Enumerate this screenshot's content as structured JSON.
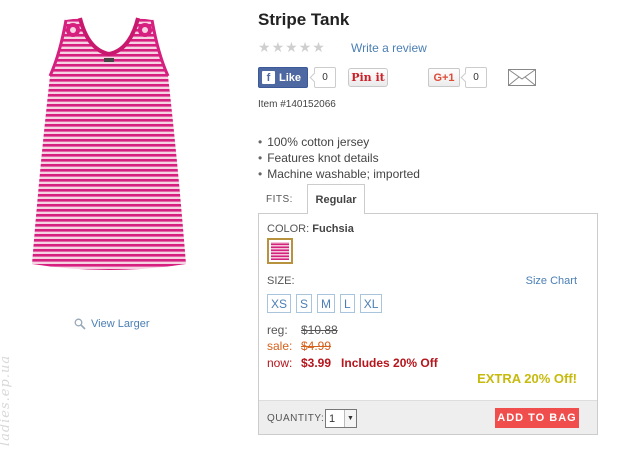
{
  "product": {
    "title": "Stripe Tank",
    "image_alt": "Fuchsia and white striped tank top with knot details",
    "item_number": "Item #140152066",
    "view_larger": "View Larger",
    "features": [
      "100% cotton jersey",
      "Features knot details",
      "Machine washable; imported"
    ]
  },
  "reviews": {
    "rating": 0,
    "max_rating": 5,
    "write_review": "Write a review"
  },
  "social": {
    "fb_label": "Like",
    "fb_icon_letter": "f",
    "fb_count": "0",
    "pin_label": "Pin it",
    "gplus_label": "G+1",
    "gplus_count": "0",
    "email_icon": "envelope-icon"
  },
  "tabs": {
    "fits_label": "FITS:",
    "active": "Regular"
  },
  "options": {
    "color_label": "COLOR:",
    "color_value": "Fuchsia",
    "swatch_colors": {
      "stripe": "#d4217c",
      "base": "#f3c6dc"
    },
    "size_label": "SIZE:",
    "size_chart": "Size Chart",
    "sizes": [
      "XS",
      "S",
      "M",
      "L",
      "XL"
    ]
  },
  "pricing": {
    "reg_label": "reg:",
    "reg_value": "$10.88",
    "sale_label": "sale:",
    "sale_value": "$4.99",
    "now_label": "now:",
    "now_value": "$3.99",
    "promo": "Includes 20% Off",
    "extra": "EXTRA 20% Off!"
  },
  "purchase": {
    "quantity_label": "QUANTITY:",
    "quantity_value": "1",
    "add_to_bag": "ADD TO BAG"
  },
  "watermark": "ladies.ep.ua",
  "colors": {
    "link": "#4b7fb4",
    "sale": "#d4611c",
    "now": "#b5151c",
    "extra": "#c7ba0c",
    "add_to_bag": "#ef4e4c",
    "fuchsia": "#d4217c"
  }
}
